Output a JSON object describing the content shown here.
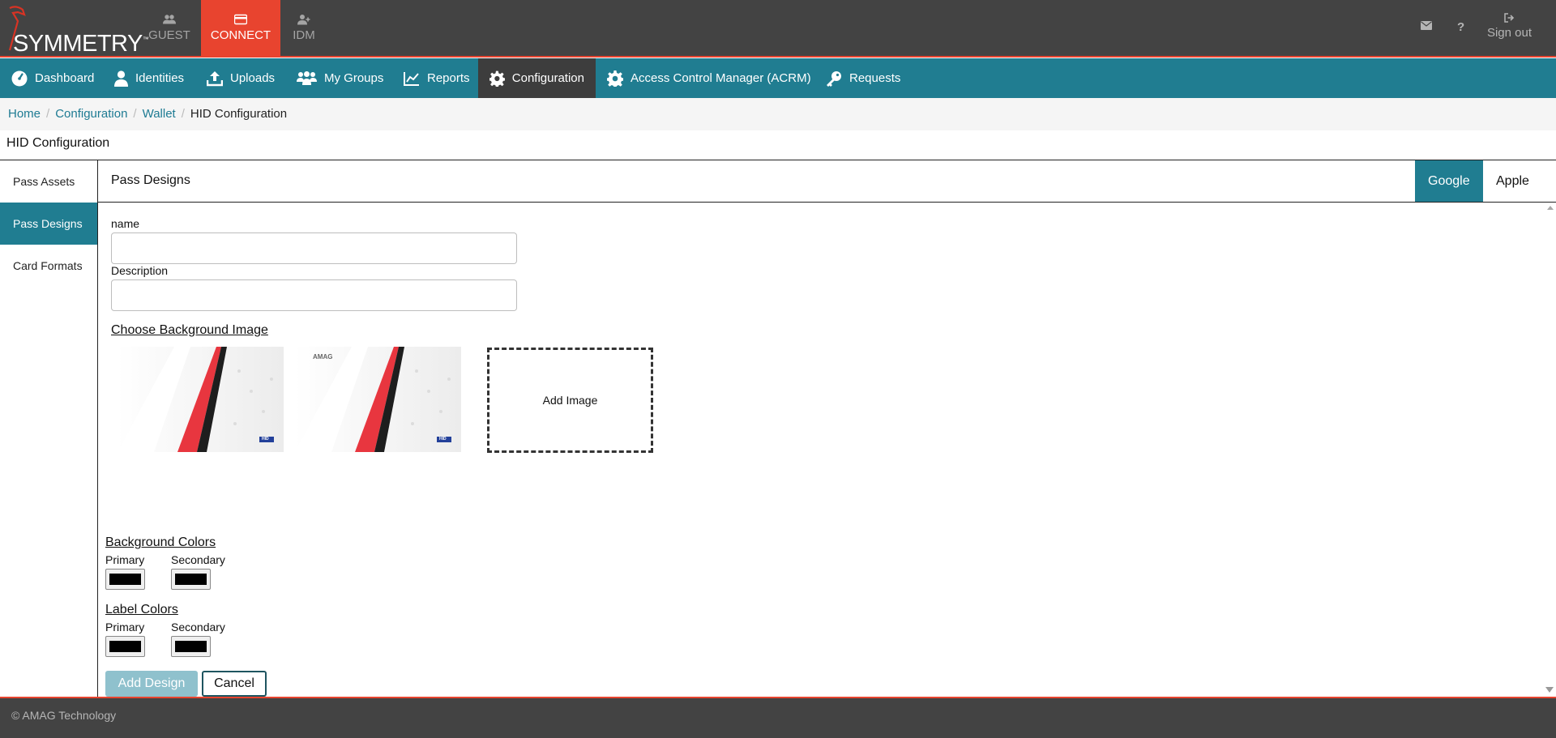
{
  "brand": {
    "name": "SYMMETRY",
    "trademark": "™",
    "accent": "#e8442f",
    "primary": "#207d91",
    "dark": "#434343"
  },
  "app_tabs": [
    {
      "label": "GUEST",
      "icon": "users-icon"
    },
    {
      "label": "CONNECT",
      "icon": "card-icon",
      "active": true
    },
    {
      "label": "IDM",
      "icon": "user-plus-icon"
    }
  ],
  "header_right": {
    "mail_icon": "envelope-icon",
    "help_icon": "question-icon",
    "signout_label": "Sign out"
  },
  "nav": {
    "items": [
      {
        "label": "Dashboard",
        "icon": "dashboard-icon"
      },
      {
        "label": "Identities",
        "icon": "user-icon"
      },
      {
        "label": "Uploads",
        "icon": "upload-icon"
      },
      {
        "label": "My Groups",
        "icon": "group-icon"
      },
      {
        "label": "Reports",
        "icon": "line-chart-icon"
      },
      {
        "label": "Configuration",
        "icon": "gear-icon",
        "active": true
      },
      {
        "label": "Access Control Manager (ACRM)",
        "icon": "gear-icon"
      },
      {
        "label": "Requests",
        "icon": "key-icon"
      }
    ]
  },
  "breadcrumb": {
    "items": [
      "Home",
      "Configuration",
      "Wallet"
    ],
    "current": "HID Configuration"
  },
  "page_title": "HID Configuration",
  "side_menu": [
    {
      "label": "Pass Assets"
    },
    {
      "label": "Pass Designs",
      "active": true
    },
    {
      "label": "Card Formats"
    }
  ],
  "panel": {
    "title": "Pass Designs",
    "platform_tabs": [
      {
        "label": "Google",
        "active": true
      },
      {
        "label": "Apple"
      }
    ]
  },
  "form": {
    "name_label": "name",
    "name_value": "",
    "description_label": "Description",
    "description_value": "",
    "choose_image_label": "Choose Background Image",
    "thumbnail_badge": "HID",
    "thumbnail_logo": "AMAG",
    "add_image_label": "Add Image",
    "background_colors": {
      "title": "Background Colors",
      "primary_label": "Primary",
      "secondary_label": "Secondary",
      "primary_value": "#000000",
      "secondary_value": "#000000"
    },
    "label_colors": {
      "title": "Label Colors",
      "primary_label": "Primary",
      "secondary_label": "Secondary",
      "primary_value": "#000000",
      "secondary_value": "#000000"
    },
    "add_button": "Add Design",
    "cancel_button": "Cancel"
  },
  "footer": {
    "copyright": "© AMAG Technology"
  }
}
